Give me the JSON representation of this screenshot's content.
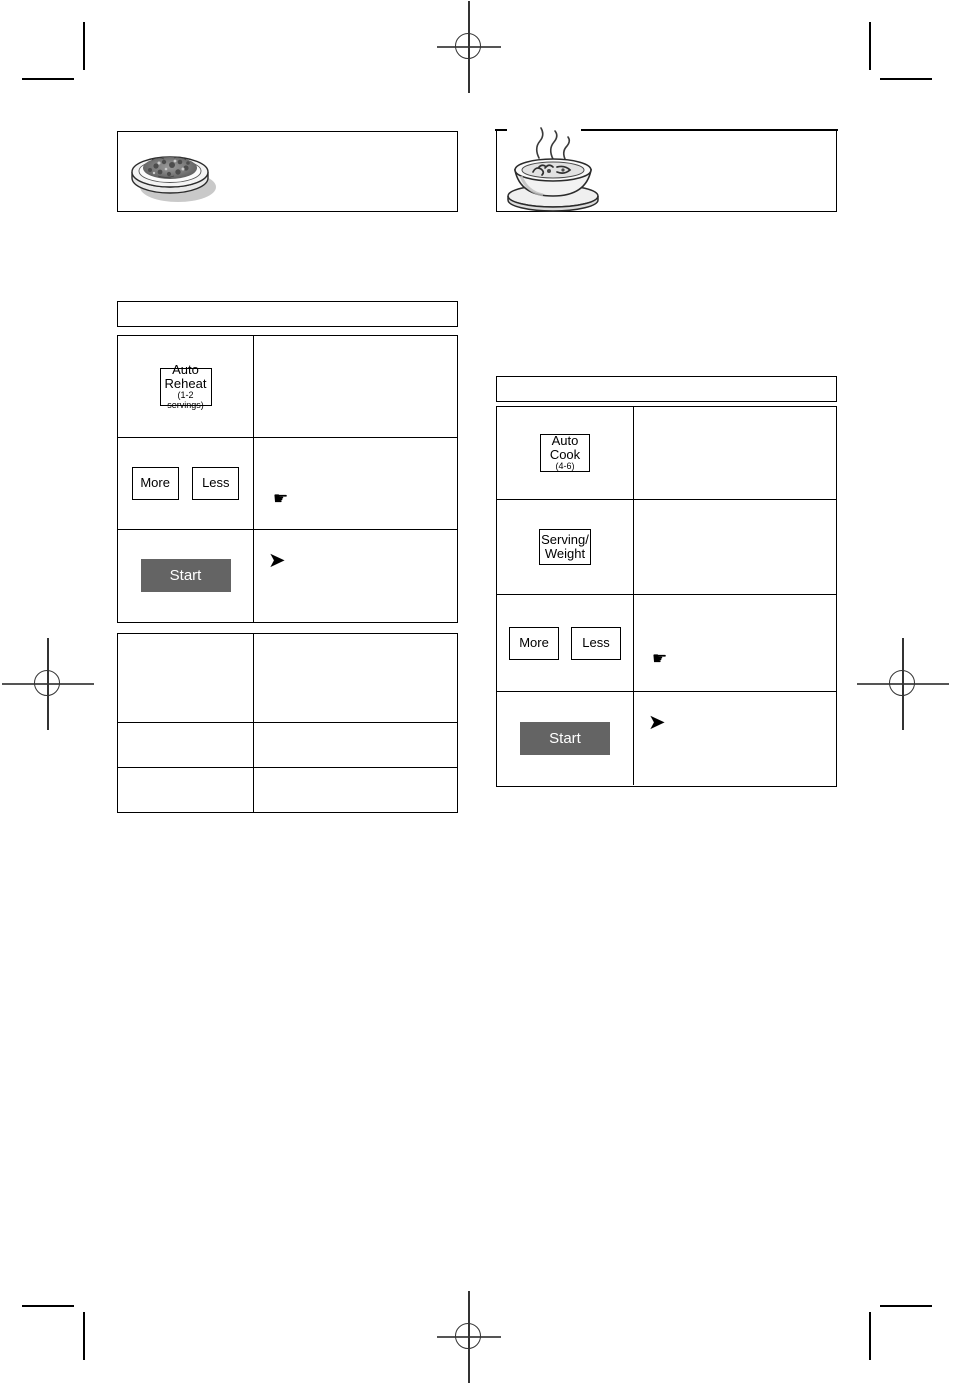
{
  "page": {
    "kind": "microwave-oven-manual-page",
    "background_color": "#ffffff",
    "ink_color": "#000000"
  },
  "print_marks": {
    "crop_mark_label": "crop-mark",
    "registration_mark_label": "registration-target"
  },
  "illustrations": {
    "plate": {
      "name": "plate-of-food",
      "caption": ""
    },
    "soup_bowl": {
      "name": "steaming-soup-bowl",
      "caption": ""
    }
  },
  "left_panel": {
    "header_bar_text": "",
    "steps_table": {
      "rows": [
        {
          "button": {
            "line1": "Auto",
            "line2": "Reheat",
            "line3": "(1-2 servings)"
          },
          "instruction": ""
        },
        {
          "buttons": [
            {
              "label": "More"
            },
            {
              "label": "Less"
            }
          ],
          "icon": "pointing-hand",
          "icon_glyph": "☛",
          "instruction": ""
        },
        {
          "start_button": {
            "label": "Start",
            "color": "#646464"
          },
          "icon": "arrowhead",
          "icon_glyph": "➤",
          "instruction": ""
        }
      ]
    },
    "notes_table": {
      "rows": [
        {
          "label": "",
          "text": ""
        },
        {
          "label": "",
          "text": ""
        },
        {
          "label": "",
          "text": ""
        }
      ]
    }
  },
  "right_panel": {
    "header_bar_text": "",
    "steps_table": {
      "rows": [
        {
          "button": {
            "line1": "Auto",
            "line2": "Cook",
            "line3": "(4-6)"
          },
          "instruction": ""
        },
        {
          "button": {
            "line1": "Serving/",
            "line2": "Weight",
            "line3": ""
          },
          "instruction": ""
        },
        {
          "buttons": [
            {
              "label": "More"
            },
            {
              "label": "Less"
            }
          ],
          "icon": "pointing-hand",
          "icon_glyph": "☛",
          "instruction": ""
        },
        {
          "start_button": {
            "label": "Start",
            "color": "#646464"
          },
          "icon": "arrowhead",
          "icon_glyph": "➤",
          "instruction": ""
        }
      ]
    }
  }
}
